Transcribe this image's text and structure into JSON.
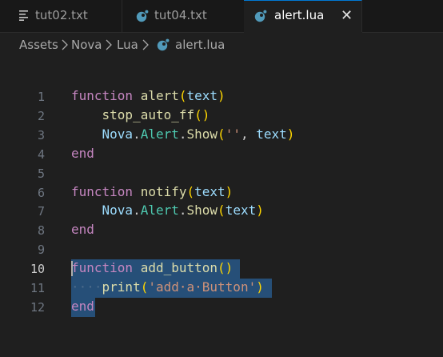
{
  "tabs": [
    {
      "label": "tut02.txt",
      "icon": "lines-icon",
      "active": false
    },
    {
      "label": "tut04.txt",
      "icon": "lua-icon",
      "active": false
    },
    {
      "label": "alert.lua",
      "icon": "lua-icon",
      "active": true
    }
  ],
  "close_glyph": "✕",
  "breadcrumb": [
    "Assets",
    "Nova",
    "Lua",
    "alert.lua"
  ],
  "colors": {
    "accent": "#0078d4",
    "lua_icon": "#519aba",
    "keyword": "#c586c0",
    "function": "#dcdcaa",
    "variable": "#9cdcfe",
    "type": "#4ec9b0",
    "string": "#ce9178",
    "selection": "#264f78"
  },
  "editor": {
    "current_line": 10,
    "lines": [
      {
        "n": "1",
        "tokens": [
          {
            "t": "function",
            "c": "kw"
          },
          {
            "t": " "
          },
          {
            "t": "alert",
            "c": "fn"
          },
          {
            "t": "(",
            "c": "br1"
          },
          {
            "t": "text",
            "c": "id"
          },
          {
            "t": ")",
            "c": "br1"
          }
        ]
      },
      {
        "n": "2",
        "tokens": [
          {
            "t": "    "
          },
          {
            "t": "stop_auto_ff",
            "c": "fn"
          },
          {
            "t": "()",
            "c": "br1"
          }
        ]
      },
      {
        "n": "3",
        "tokens": [
          {
            "t": "    "
          },
          {
            "t": "Nova",
            "c": "id"
          },
          {
            "t": "."
          },
          {
            "t": "Alert",
            "c": "ty"
          },
          {
            "t": "."
          },
          {
            "t": "Show",
            "c": "fn"
          },
          {
            "t": "(",
            "c": "br1"
          },
          {
            "t": "''",
            "c": "str"
          },
          {
            "t": ", "
          },
          {
            "t": "text",
            "c": "id"
          },
          {
            "t": ")",
            "c": "br1"
          }
        ]
      },
      {
        "n": "4",
        "tokens": [
          {
            "t": "end",
            "c": "kw"
          }
        ]
      },
      {
        "n": "5",
        "tokens": []
      },
      {
        "n": "6",
        "tokens": [
          {
            "t": "function",
            "c": "kw"
          },
          {
            "t": " "
          },
          {
            "t": "notify",
            "c": "fn"
          },
          {
            "t": "(",
            "c": "br1"
          },
          {
            "t": "text",
            "c": "id"
          },
          {
            "t": ")",
            "c": "br1"
          }
        ]
      },
      {
        "n": "7",
        "tokens": [
          {
            "t": "    "
          },
          {
            "t": "Nova",
            "c": "id"
          },
          {
            "t": "."
          },
          {
            "t": "Alert",
            "c": "ty"
          },
          {
            "t": "."
          },
          {
            "t": "Show",
            "c": "fn"
          },
          {
            "t": "(",
            "c": "br1"
          },
          {
            "t": "text",
            "c": "id"
          },
          {
            "t": ")",
            "c": "br1"
          }
        ]
      },
      {
        "n": "8",
        "tokens": [
          {
            "t": "end",
            "c": "kw"
          }
        ]
      },
      {
        "n": "9",
        "tokens": []
      },
      {
        "n": "10",
        "tokens": [
          {
            "t": "function",
            "c": "kw"
          },
          {
            "t": " "
          },
          {
            "t": "add_button",
            "c": "fn"
          },
          {
            "t": "()",
            "c": "br1"
          }
        ]
      },
      {
        "n": "11",
        "tokens": [
          {
            "t": "····",
            "c": "ws"
          },
          {
            "t": "print",
            "c": "fn"
          },
          {
            "t": "(",
            "c": "br1"
          },
          {
            "t": "'add·a·Button'",
            "c": "str"
          },
          {
            "t": ")",
            "c": "br1"
          }
        ]
      },
      {
        "n": "12",
        "tokens": [
          {
            "t": "end",
            "c": "kw"
          }
        ]
      }
    ]
  }
}
